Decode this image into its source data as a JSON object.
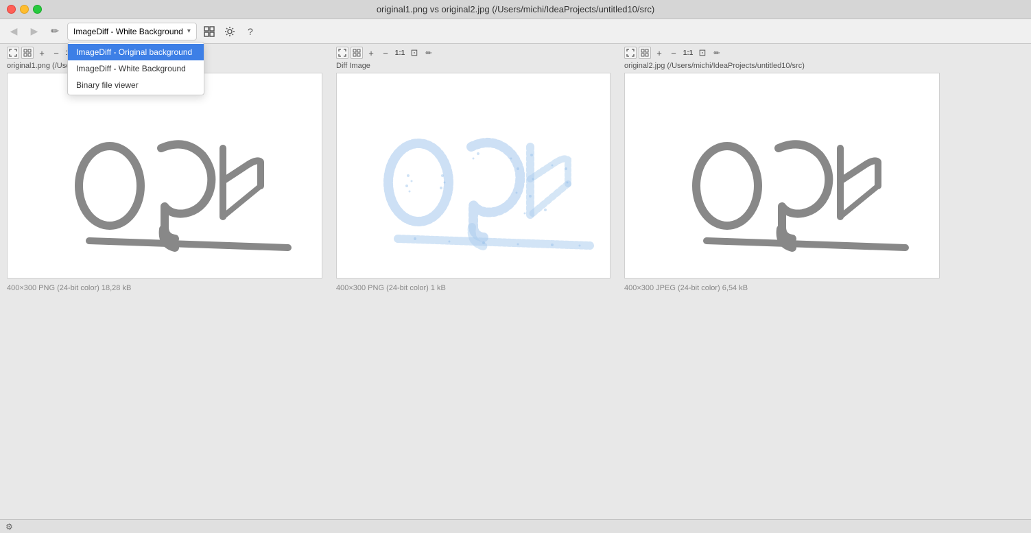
{
  "titlebar": {
    "title": "original1.png vs original2.jpg (/Users/michi/IdeaProjects/untitled10/src)"
  },
  "toolbar": {
    "nav_back_label": "◀",
    "nav_forward_label": "▶",
    "edit_label": "✏",
    "dropdown_selected": "ImageDiff - White Background",
    "dropdown_arrow": "▾",
    "settings_label": "⚙",
    "refresh_label": "↻",
    "help_label": "?",
    "dropdown_items": [
      {
        "label": "ImageDiff - Original background",
        "selected": true
      },
      {
        "label": "ImageDiff - White Background",
        "selected": false
      },
      {
        "label": "Binary file viewer",
        "selected": false
      }
    ]
  },
  "panels": {
    "left": {
      "title": "original1.png (/Users/michi/IdeaProjects/untitled10/src)",
      "meta": "400×300 PNG (24-bit color) 18,28 kB"
    },
    "center": {
      "title": "Diff Image",
      "meta": "400×300 PNG (24-bit color) 1 kB"
    },
    "right": {
      "title": "original2.jpg (/Users/michi/IdeaProjects/untitled10/src)",
      "meta": "400×300 JPEG (24-bit color) 6,54 kB"
    }
  },
  "statusbar": {
    "icon": "⚙",
    "text": ""
  },
  "colors": {
    "selected_blue": "#3d7fe6",
    "diff_blue": "#8ab4e0"
  }
}
